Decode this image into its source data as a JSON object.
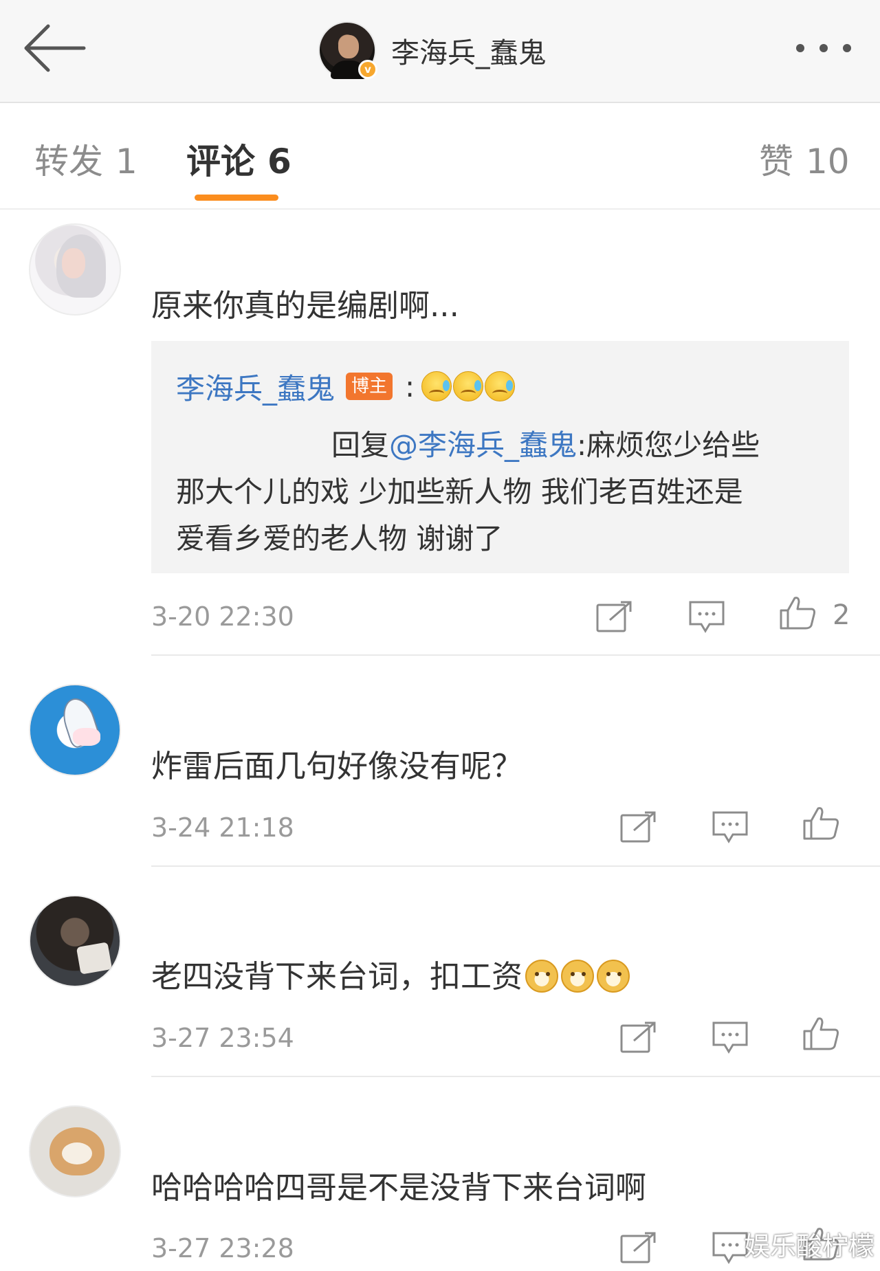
{
  "header": {
    "username": "李海兵_蠢鬼",
    "verified_badge": "v"
  },
  "tabs": {
    "repost_label": "转发",
    "repost_count": "1",
    "comments_label": "评论",
    "comments_count": "6",
    "likes_label": "赞",
    "likes_count": "10"
  },
  "comments": [
    {
      "text": "原来你真的是编剧啊...",
      "quote": {
        "author": "李海兵_蠢鬼",
        "badge": "博主",
        "colon": ":",
        "emoji": "sad-sweat-emoji",
        "reply_prefix": "回复",
        "mention": "@李海兵_蠢鬼",
        "line1_rest": ":麻烦您少给些",
        "line2": "那大个儿的戏 少加些新人物 我们老百姓还是",
        "line3": "爱看乡爱的老人物 谢谢了"
      },
      "time": "3-20 22:30",
      "likes": "2"
    },
    {
      "text": "炸雷后面几句好像没有呢？",
      "time": "3-24 21:18"
    },
    {
      "text": "老四没背下来台词，扣工资",
      "emoji": "doge-emoji",
      "time": "3-27 23:54"
    },
    {
      "text": "哈哈哈哈四哥是不是没背下来台词啊",
      "time": "3-27 23:28"
    }
  ],
  "watermark": "娱乐酸柠檬",
  "colors": {
    "accent_orange": "#fb8d1e",
    "link_blue": "#3d77c2",
    "blogger_badge": "#f2762e"
  }
}
